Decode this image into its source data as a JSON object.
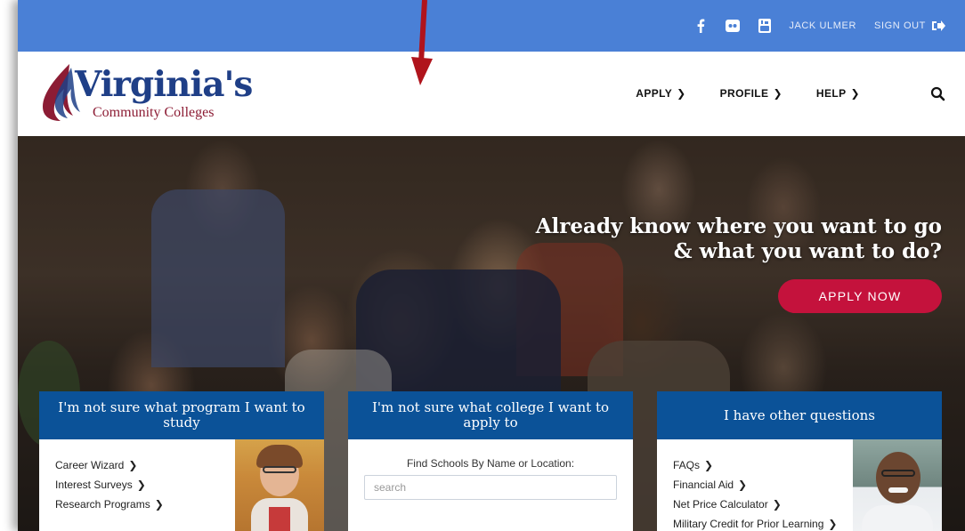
{
  "topbar": {
    "social": [
      "facebook-icon",
      "flickr-icon",
      "youtube-icon"
    ],
    "user_name": "JACK ULMER",
    "sign_out": "SIGN OUT"
  },
  "logo": {
    "main": "Virginia's",
    "sub": "Community Colleges"
  },
  "nav": {
    "items": [
      "APPLY",
      "PROFILE",
      "HELP"
    ]
  },
  "hero": {
    "title_line1": "Already know where you want to go",
    "title_line2": "& what you want to do?",
    "cta": "APPLY NOW"
  },
  "cards": {
    "program": {
      "title": "I'm not sure what program I want to study",
      "links": [
        "Career Wizard",
        "Interest Surveys",
        "Research Programs"
      ]
    },
    "college": {
      "title": "I'm not sure what college I want to apply to",
      "find_label": "Find Schools By Name or Location:",
      "search_placeholder": "search"
    },
    "other": {
      "title": "I have other questions",
      "links": [
        "FAQs",
        "Financial Aid",
        "Net Price Calculator",
        "Military Credit for Prior Learning"
      ]
    }
  },
  "colors": {
    "topbar": "#4a80d6",
    "card_header": "#0b5298",
    "cta": "#c4123c",
    "logo_blue": "#1f3f87",
    "logo_maroon": "#8c1c34",
    "annotation_arrow": "#b0141c"
  }
}
